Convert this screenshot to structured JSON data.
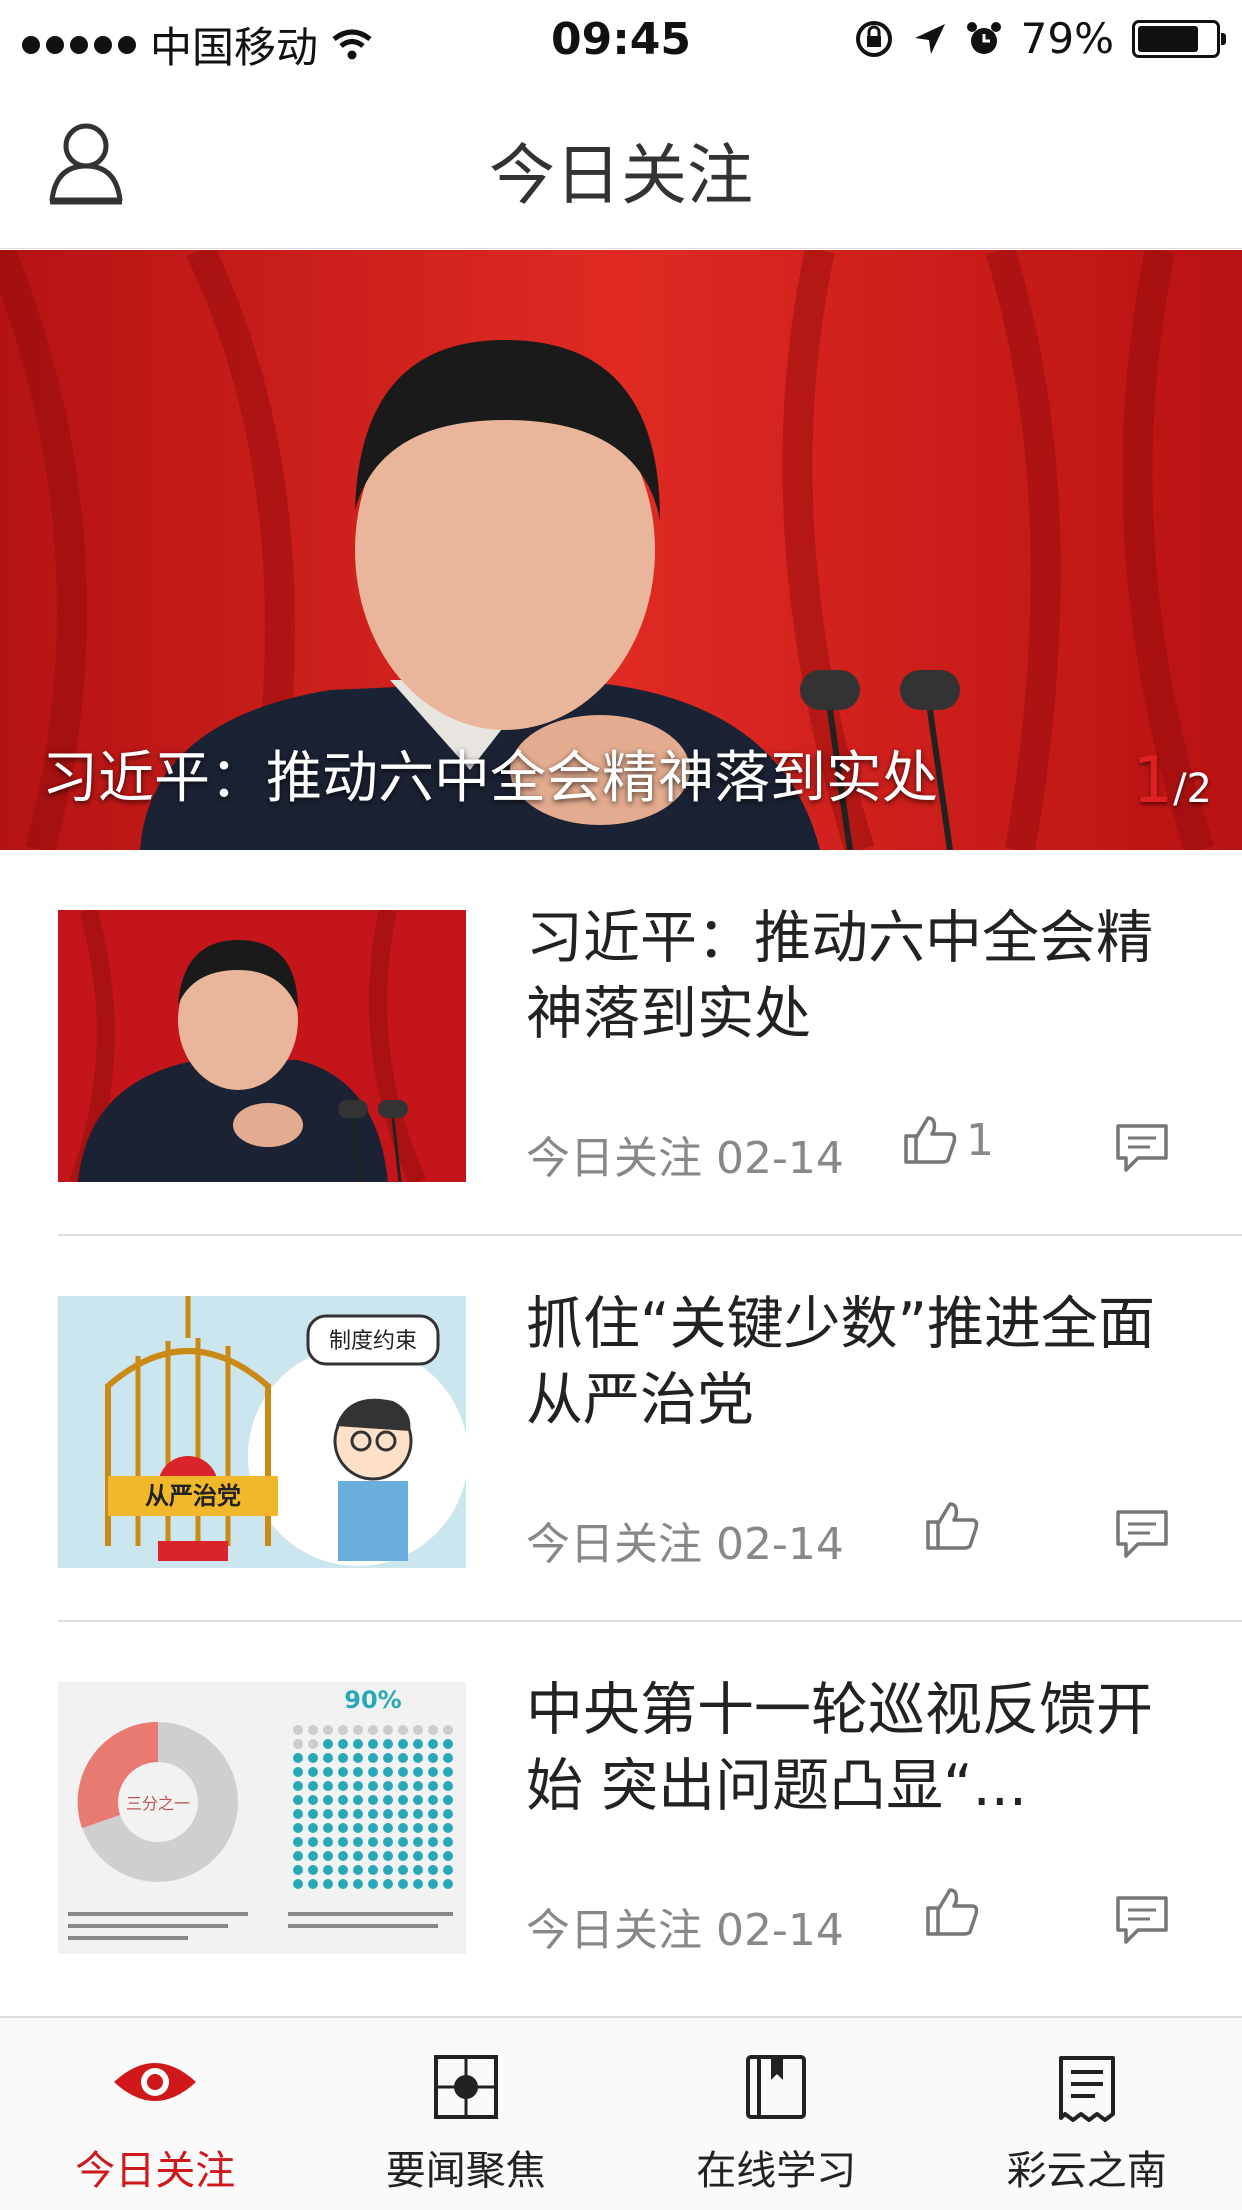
{
  "status_bar": {
    "carrier": "中国移动",
    "time": "09:45",
    "battery": "79%",
    "battery_level": 0.79
  },
  "nav": {
    "title": "今日关注",
    "profile_icon": "user-icon"
  },
  "banner": {
    "caption": "习近平：推动六中全会精神落到实处",
    "current_page": "1",
    "total_pages": "/2"
  },
  "news": [
    {
      "title": "习近平：推动六中全会精神落到实处",
      "source_date": "今日关注 02-14",
      "likes": "1",
      "thumb_icon": "portrait-photo"
    },
    {
      "title": "抓住“关键少数”推进全面从严治党",
      "source_date": "今日关注 02-14",
      "likes": "",
      "thumb_icon": "cartoon-illustration",
      "thumb_text_1": "制度约束",
      "thumb_text_2": "从严治党"
    },
    {
      "title": "中央第十一轮巡视反馈开始 突出问题凸显“...",
      "source_date": "今日关注 02-14",
      "likes": "",
      "thumb_icon": "infographic",
      "thumb_text_1": "90%",
      "thumb_text_2": "三分之一"
    }
  ],
  "tabs": [
    {
      "label": "今日关注",
      "icon": "eye-icon",
      "active": true
    },
    {
      "label": "要闻聚焦",
      "icon": "focus-icon",
      "active": false
    },
    {
      "label": "在线学习",
      "icon": "book-icon",
      "active": false
    },
    {
      "label": "彩云之南",
      "icon": "document-icon",
      "active": false
    }
  ],
  "colors": {
    "accent": "#d0181b",
    "text": "#222222",
    "muted": "#888888"
  }
}
